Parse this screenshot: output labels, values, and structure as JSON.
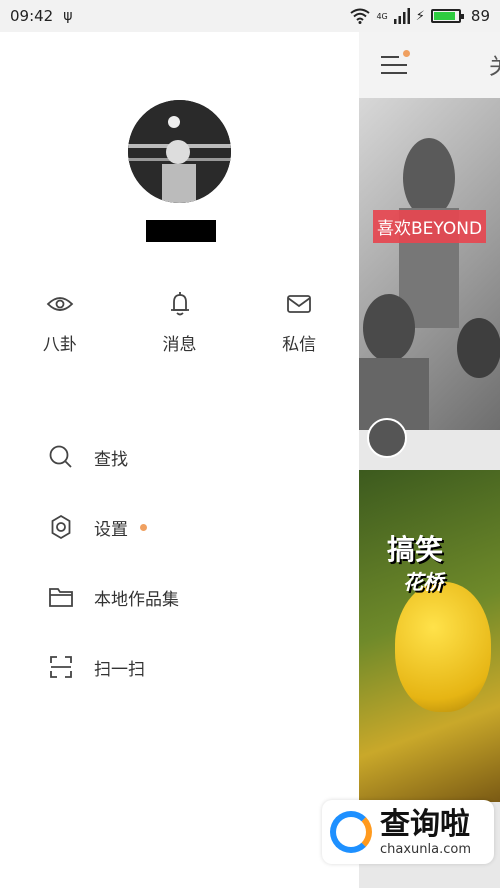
{
  "status": {
    "time": "09:42",
    "network": "4G",
    "battery": "89",
    "battery_level": 0.89
  },
  "quick_actions": [
    {
      "icon": "eye-icon",
      "label": "八卦"
    },
    {
      "icon": "bell-icon",
      "label": "消息"
    },
    {
      "icon": "mail-icon",
      "label": "私信"
    }
  ],
  "menu": [
    {
      "icon": "search-icon",
      "label": "查找",
      "dot": false
    },
    {
      "icon": "gear-icon",
      "label": "设置",
      "dot": true
    },
    {
      "icon": "folder-icon",
      "label": "本地作品集",
      "dot": false
    },
    {
      "icon": "scan-icon",
      "label": "扫一扫",
      "dot": false
    }
  ],
  "feed": {
    "header_char": "关",
    "card1_caption": "喜欢BEYOND",
    "card2_title": "搞笑",
    "card2_subtitle": "花桥"
  },
  "watermark": {
    "title": "查询啦",
    "url": "chaxunla.com"
  },
  "colors": {
    "accent_dot": "#f0a060",
    "caption_bg": "#e64650"
  }
}
